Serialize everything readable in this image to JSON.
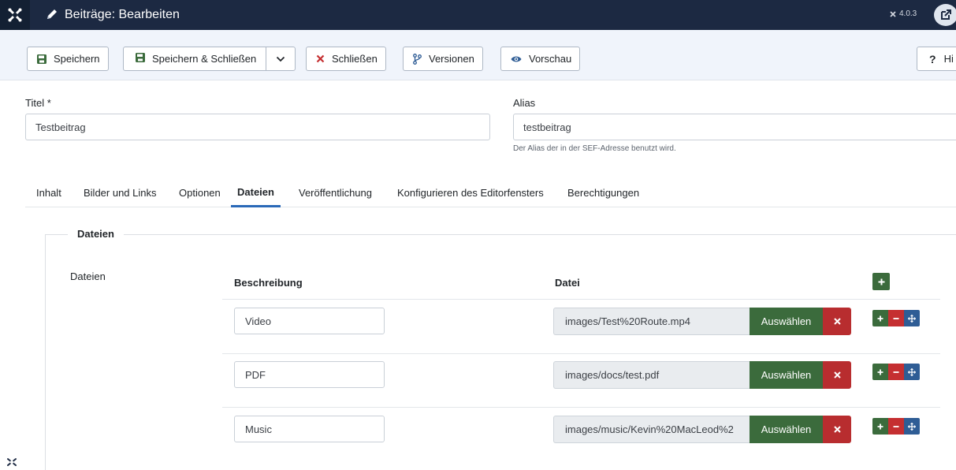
{
  "header": {
    "title": "Beiträge: Bearbeiten",
    "version": "4.0.3"
  },
  "toolbar": {
    "save": "Speichern",
    "save_close": "Speichern & Schließen",
    "close": "Schließen",
    "versions": "Versionen",
    "preview": "Vorschau",
    "help": "Hi"
  },
  "form": {
    "title_label": "Titel *",
    "title_value": "Testbeitrag",
    "alias_label": "Alias",
    "alias_value": "testbeitrag",
    "alias_hint": "Der Alias der in der SEF-Adresse benutzt wird."
  },
  "tabs": [
    {
      "label": "Inhalt"
    },
    {
      "label": "Bilder und Links"
    },
    {
      "label": "Optionen"
    },
    {
      "label": "Dateien"
    },
    {
      "label": "Veröffentlichung"
    },
    {
      "label": "Konfigurieren des Editorfensters"
    },
    {
      "label": "Berechtigungen"
    }
  ],
  "active_tab": "Dateien",
  "files": {
    "legend": "Dateien",
    "field_label": "Dateien",
    "col_description": "Beschreibung",
    "col_file": "Datei",
    "select_label": "Auswählen",
    "rows": [
      {
        "description": "Video",
        "file": "images/Test%20Route.mp4"
      },
      {
        "description": "PDF",
        "file": "images/docs/test.pdf"
      },
      {
        "description": "Music",
        "file": "images/music/Kevin%20MacLeod%2"
      }
    ]
  },
  "colors": {
    "header_bg": "#1c2942",
    "toolbar_bg": "#f0f4fb",
    "success": "#3b6b3c",
    "danger": "#b82d2f",
    "primary": "#2f5d95",
    "tab_active": "#2a69b8"
  },
  "icons": {
    "logo": "joomla-logo-icon",
    "title": "pencil-icon",
    "save": "save-icon",
    "close": "times-icon",
    "versions": "code-branch-icon",
    "preview": "eye-icon",
    "external": "external-link-icon",
    "help": "question-icon"
  }
}
